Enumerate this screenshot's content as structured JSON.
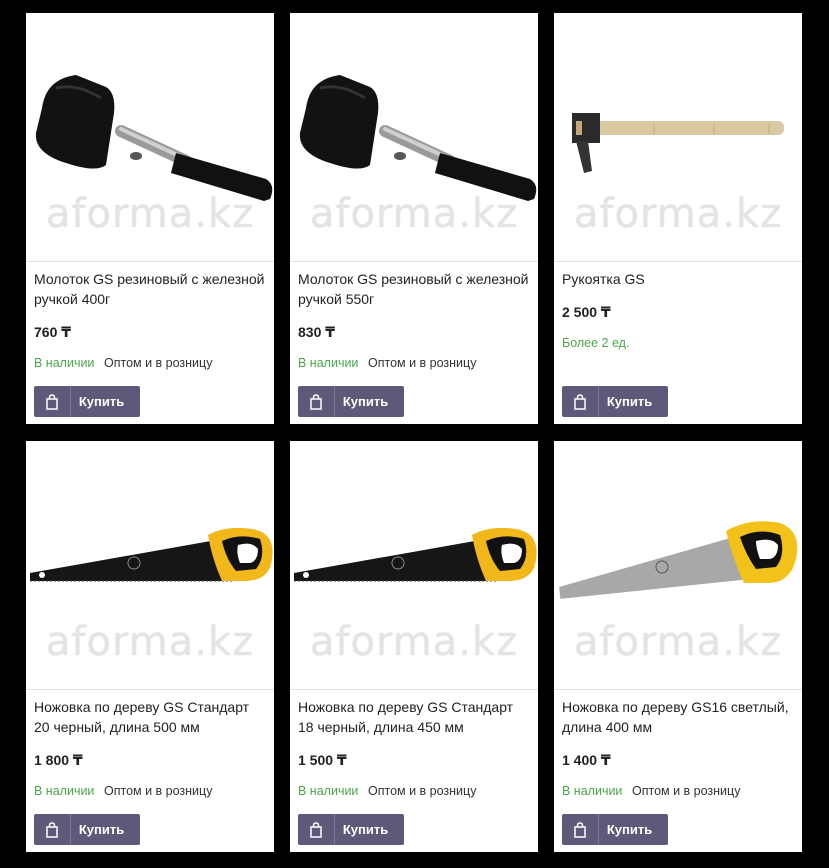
{
  "products": [
    {
      "title": "Молоток GS резиновый с железной ручкой 400г",
      "price": "760 ₸",
      "stock": "В наличии",
      "wholesale": "Оптом и в розницу",
      "buy_label": "Купить",
      "watermark": "aforma.kz",
      "icon": "rubber-mallet-image"
    },
    {
      "title": "Молоток GS резиновый с железной ручкой 550г",
      "price": "830 ₸",
      "stock": "В наличии",
      "wholesale": "Оптом и в розницу",
      "buy_label": "Купить",
      "watermark": "aforma.kz",
      "icon": "rubber-mallet-image"
    },
    {
      "title": "Рукоятка GS",
      "price": "2 500 ₸",
      "stock": "Более 2 ед.",
      "wholesale": "",
      "buy_label": "Купить",
      "watermark": "aforma.kz",
      "icon": "wooden-handle-image"
    },
    {
      "title": "Ножовка по дереву GS Стандарт 20 черный, длина 500 мм",
      "price": "1 800 ₸",
      "stock": "В наличии",
      "wholesale": "Оптом и в розницу",
      "buy_label": "Купить",
      "watermark": "aforma.kz",
      "icon": "black-handsaw-image"
    },
    {
      "title": "Ножовка по дереву GS Стандарт 18 черный, длина 450 мм",
      "price": "1 500 ₸",
      "stock": "В наличии",
      "wholesale": "Оптом и в розницу",
      "buy_label": "Купить",
      "watermark": "aforma.kz",
      "icon": "black-handsaw-image"
    },
    {
      "title": "Ножовка по дереву GS16 светлый, длина 400 мм",
      "price": "1 400 ₸",
      "stock": "В наличии",
      "wholesale": "Оптом и в розницу",
      "buy_label": "Купить",
      "watermark": "aforma.kz",
      "icon": "silver-handsaw-image"
    }
  ],
  "colors": {
    "background": "#000000",
    "button": "#5f5878",
    "in_stock": "#4ca64c"
  }
}
